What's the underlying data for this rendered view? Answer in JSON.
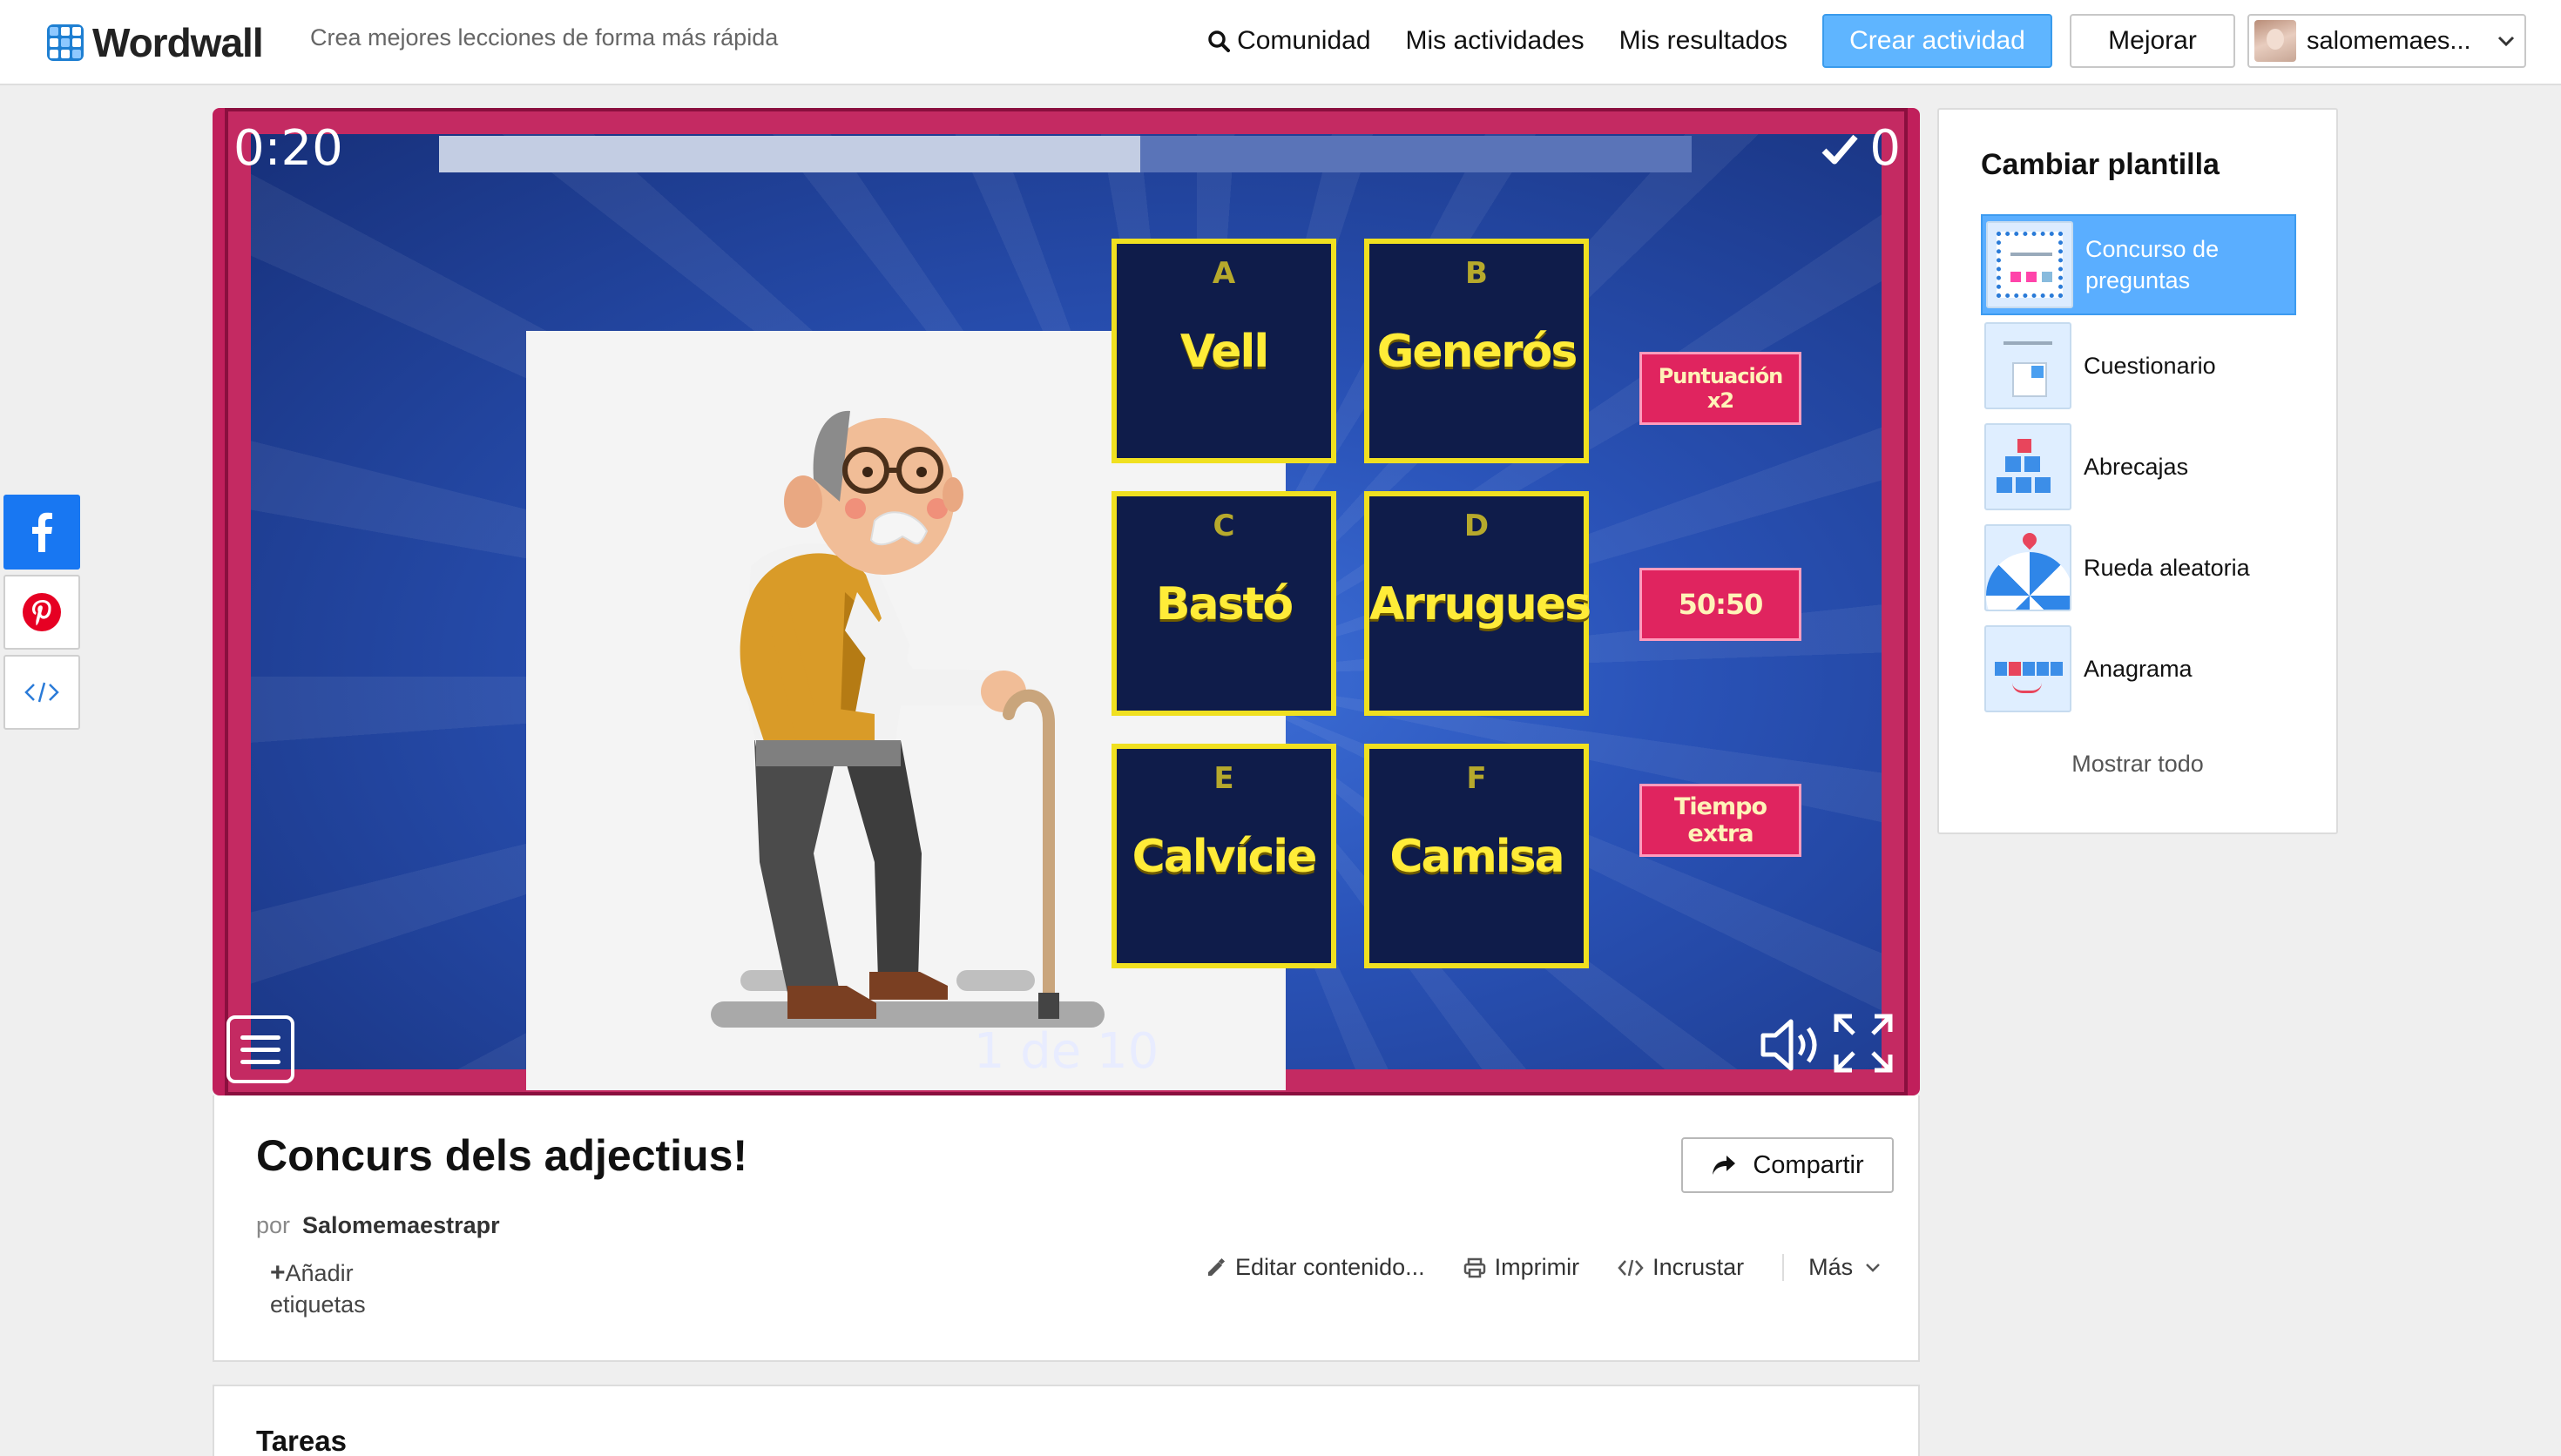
{
  "header": {
    "logo_text": "Wordwall",
    "tagline": "Crea mejores lecciones de forma más rápida",
    "nav": {
      "community": "Comunidad",
      "my_activities": "Mis actividades",
      "my_results": "Mis resultados"
    },
    "create_button": "Crear actividad",
    "upgrade_button": "Mejorar",
    "user_name": "salomemaes..."
  },
  "social": [
    "facebook-icon",
    "pinterest-icon",
    "embed-icon"
  ],
  "game": {
    "timer": "0:20",
    "progress_fraction": 0.56,
    "score": "0",
    "page_counter": "1 de 10",
    "answers": [
      {
        "letter": "A",
        "word": "Vell"
      },
      {
        "letter": "B",
        "word": "Generós"
      },
      {
        "letter": "C",
        "word": "Bastó"
      },
      {
        "letter": "D",
        "word": "Arrugues"
      },
      {
        "letter": "E",
        "word": "Calvície"
      },
      {
        "letter": "F",
        "word": "Camisa"
      }
    ],
    "powerups": {
      "double": "Puntuación x2",
      "fifty": "50:50",
      "time": "Tiempo extra"
    },
    "colors": {
      "tile_border": "#f0e020",
      "tile_text": "#ffec38",
      "frame": "#c42a62",
      "powerup": "#e0245f"
    }
  },
  "activity": {
    "title": "Concurs dels adjectius!",
    "share_label": "Compartir",
    "by_label": "por",
    "author": "Salomemaestrapr",
    "add_tags_plus": "+",
    "add_tags": "Añadir etiquetas",
    "actions": {
      "edit": "Editar contenido...",
      "print": "Imprimir",
      "embed": "Incrustar",
      "more": "Más"
    }
  },
  "tasks": {
    "title": "Tareas"
  },
  "templates": {
    "title": "Cambiar plantilla",
    "items": [
      {
        "label": "Concurso de preguntas",
        "active": true
      },
      {
        "label": "Cuestionario",
        "active": false
      },
      {
        "label": "Abrecajas",
        "active": false
      },
      {
        "label": "Rueda aleatoria",
        "active": false
      },
      {
        "label": "Anagrama",
        "active": false
      }
    ],
    "show_all": "Mostrar todo"
  }
}
